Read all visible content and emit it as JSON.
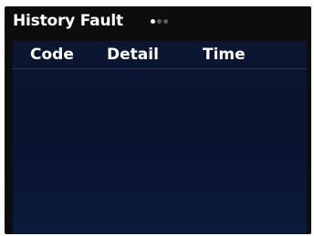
{
  "header": {
    "title": "History Fault",
    "pager": {
      "pages": 3,
      "current": 1
    }
  },
  "table": {
    "columns": [
      "Code",
      "Detail",
      "Time"
    ],
    "rows": []
  },
  "colors": {
    "screen_background": "#0d0d10",
    "panel_background": "#0b1632",
    "text": "#ffffff",
    "pager_active": "#ffffff",
    "pager_inactive": "#5c5c5c"
  }
}
